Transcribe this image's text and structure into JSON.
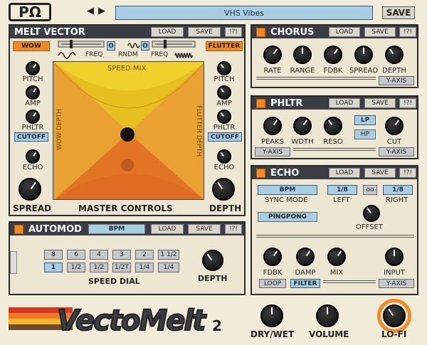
{
  "app": {
    "logo": "PΩ",
    "preset": "VHS Vibes",
    "save": "SAVE",
    "nav_prev": "◀",
    "nav_next": "▶"
  },
  "melt": {
    "title": "MELT VECTOR",
    "load": "LOAD",
    "save": "SAVE",
    "help": "!?!",
    "wow": "WOW",
    "flutter": "FLUTTER",
    "freq_left": "FREQ",
    "freq_right": "FREQ",
    "rndm": "RNDM",
    "o_left": "O",
    "o_right": "O",
    "pad_top": "SPEED MIX",
    "pad_left": "WOW DEPTH",
    "pad_right": "FLUTTER DEPTH",
    "left_knobs": [
      "PITCH",
      "AMP",
      "PHLTR",
      "ECHO"
    ],
    "right_knobs": [
      "PITCH",
      "AMP",
      "PHLTR",
      "ECHO"
    ],
    "cutoff": "CUTOFF",
    "spread": "SPREAD",
    "master": "MASTER CONTROLS",
    "depth": "DEPTH"
  },
  "chorus": {
    "title": "CHORUS",
    "load": "LOAD",
    "save": "SAVE",
    "help": "!?!",
    "knobs": [
      "RATE",
      "RANGE",
      "FDBK",
      "SPREAD",
      "DEPTH"
    ],
    "yaxis": "Y-AXIS"
  },
  "phltr": {
    "title": "PHLTR",
    "load": "LOAD",
    "save": "SAVE",
    "help": "!?!",
    "knobs": [
      "PEAKS",
      "WDTH",
      "RESO",
      "CUT"
    ],
    "lp": "LP",
    "hp": "HP",
    "yaxis_left": "Y-AXIS",
    "yaxis_right": "Y-AXIS"
  },
  "echo": {
    "title": "ECHO",
    "load": "LOAD",
    "save": "SAVE",
    "help": "!?!",
    "sync_value": "BPM",
    "sync_label": "SYNC MODE",
    "left_value": "1/8",
    "left_label": "LEFT",
    "link": "oo",
    "right_value": "1/8",
    "right_label": "RIGHT",
    "pingpong": "PINGPONG",
    "offset": "OFFSET",
    "knobs": [
      "FDBK",
      "DAMP",
      "MIX",
      "INPUT"
    ],
    "loop": "LOOP",
    "filter": "FILTER",
    "yaxis": "Y-AXIS"
  },
  "automod": {
    "title": "AUTOMOD",
    "mode": "BPM",
    "load": "LOAD",
    "save": "SAVE",
    "help": "!?!",
    "row1": [
      "8",
      "6",
      "4",
      "3",
      "2",
      "1 1/2"
    ],
    "row2": [
      "1",
      "1/2",
      "1/2",
      "1/2T",
      "1/4",
      "1/4"
    ],
    "speed": "SPEED DIAL",
    "depth": "DEPTH"
  },
  "footer": {
    "brand": "VectoMelt",
    "version": "2",
    "drywet": "DRY/WET",
    "volume": "VOLUME",
    "lofi": "LO-FI"
  }
}
